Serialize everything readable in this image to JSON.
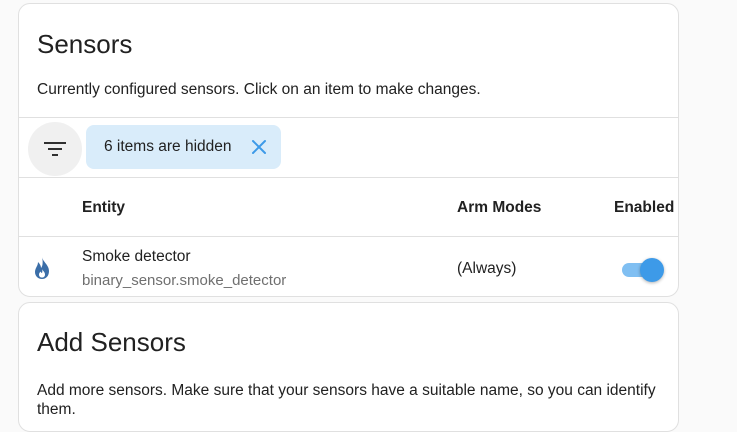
{
  "sensors_card": {
    "title": "Sensors",
    "description": "Currently configured sensors. Click on an item to make changes.",
    "filter": {
      "icon": "filter-icon",
      "chip_label": "6 items are hidden",
      "chip_close_icon": "close-icon"
    },
    "table": {
      "columns": [
        "Entity",
        "Arm Modes",
        "Enabled"
      ],
      "rows": [
        {
          "icon": "fire-icon",
          "name": "Smoke detector",
          "entity_id": "binary_sensor.smoke_detector",
          "arm_modes": "(Always)",
          "enabled": true
        }
      ]
    }
  },
  "add_card": {
    "title": "Add Sensors",
    "description": "Add more sensors. Make sure that your sensors have a suitable name, so you can identify them."
  },
  "colors": {
    "accent": "#3d9ae8",
    "chip_background": "#d9ecfa",
    "icon_blue": "#3b6ea8",
    "secondary_text": "#6f6f6f"
  }
}
